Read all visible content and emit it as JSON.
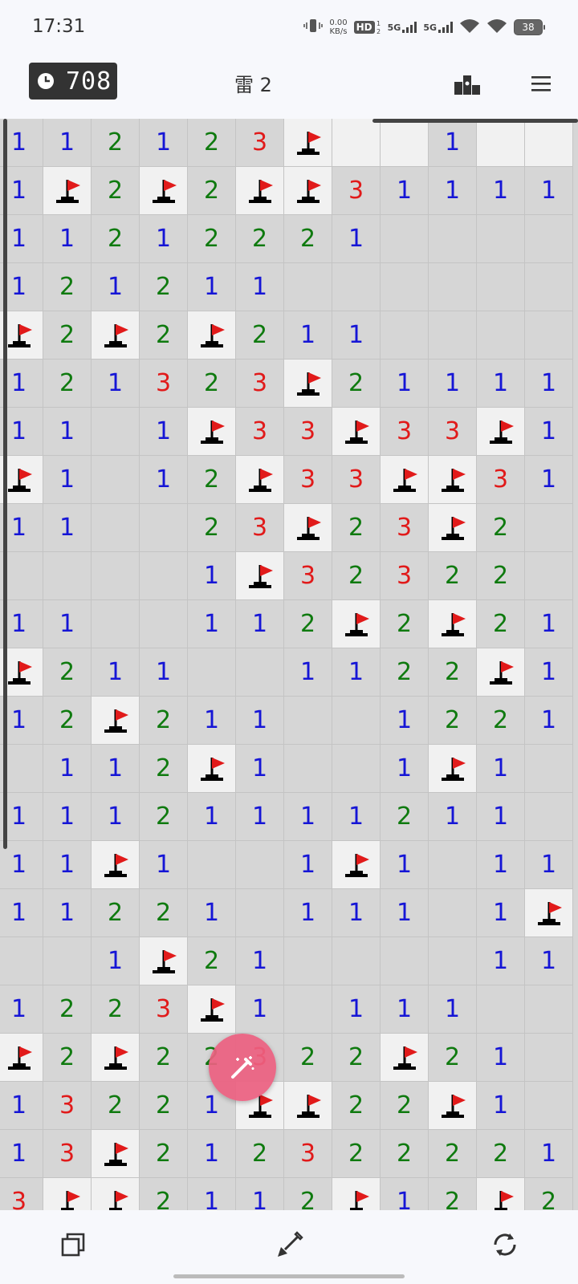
{
  "status": {
    "time": "17:31",
    "net_speed_value": "0.00",
    "net_speed_unit": "KB/s",
    "hd_label": "HD",
    "sim1_label": "5G",
    "sim2_label": "5G",
    "battery": "38"
  },
  "toolbar": {
    "timer_value": "708",
    "mine_label": "雷 2"
  },
  "board": {
    "rows": [
      [
        "1",
        "1",
        "2",
        "1",
        "2",
        "3",
        "F",
        "U",
        "U",
        "1",
        "U",
        "U"
      ],
      [
        "1",
        "F",
        "2",
        "F",
        "2",
        "F",
        "F",
        "3",
        "1",
        "1",
        "1",
        "1"
      ],
      [
        "1",
        "1",
        "2",
        "1",
        "2",
        "2",
        "2",
        "1",
        "",
        "",
        "",
        ""
      ],
      [
        "1",
        "2",
        "1",
        "2",
        "1",
        "1",
        "",
        "",
        "",
        "",
        "",
        ""
      ],
      [
        "F",
        "2",
        "F",
        "2",
        "F",
        "2",
        "1",
        "1",
        "",
        "",
        "",
        ""
      ],
      [
        "1",
        "2",
        "1",
        "3",
        "2",
        "3",
        "F",
        "2",
        "1",
        "1",
        "1",
        "1"
      ],
      [
        "1",
        "1",
        "",
        "1",
        "F",
        "3",
        "3",
        "F",
        "3",
        "3",
        "F",
        "1"
      ],
      [
        "F",
        "1",
        "",
        "1",
        "2",
        "F",
        "3",
        "3",
        "F",
        "F",
        "3",
        "1"
      ],
      [
        "1",
        "1",
        "",
        "",
        "2",
        "3",
        "F",
        "2",
        "3",
        "F",
        "2",
        ""
      ],
      [
        "",
        "",
        "",
        "",
        "1",
        "F",
        "3",
        "2",
        "3",
        "2",
        "2",
        ""
      ],
      [
        "1",
        "1",
        "",
        "",
        "1",
        "1",
        "2",
        "F",
        "2",
        "F",
        "2",
        "1"
      ],
      [
        "F",
        "2",
        "1",
        "1",
        "",
        "",
        "1",
        "1",
        "2",
        "2",
        "F",
        "1"
      ],
      [
        "1",
        "2",
        "F",
        "2",
        "1",
        "1",
        "",
        "",
        "1",
        "2",
        "2",
        "1"
      ],
      [
        "",
        "1",
        "1",
        "2",
        "F",
        "1",
        "",
        "",
        "1",
        "F",
        "1",
        ""
      ],
      [
        "1",
        "1",
        "1",
        "2",
        "1",
        "1",
        "1",
        "1",
        "2",
        "1",
        "1",
        ""
      ],
      [
        "1",
        "1",
        "F",
        "1",
        "",
        "",
        "1",
        "F",
        "1",
        "",
        "1",
        "1"
      ],
      [
        "1",
        "1",
        "2",
        "2",
        "1",
        "",
        "1",
        "1",
        "1",
        "",
        "1",
        "F"
      ],
      [
        "",
        "",
        "1",
        "F",
        "2",
        "1",
        "",
        "",
        "",
        "",
        "1",
        "1"
      ],
      [
        "1",
        "2",
        "2",
        "3",
        "F",
        "1",
        "",
        "1",
        "1",
        "1",
        "",
        ""
      ],
      [
        "F",
        "2",
        "F",
        "2",
        "2",
        "3",
        "2",
        "2",
        "F",
        "2",
        "1",
        ""
      ],
      [
        "1",
        "3",
        "2",
        "2",
        "1",
        "F",
        "F",
        "2",
        "2",
        "F",
        "1",
        ""
      ],
      [
        "1",
        "3",
        "F",
        "2",
        "1",
        "2",
        "3",
        "2",
        "2",
        "2",
        "2",
        "1"
      ],
      [
        "3",
        "F",
        "F",
        "2",
        "1",
        "1",
        "2",
        "F",
        "1",
        "2",
        "F",
        "2"
      ]
    ]
  },
  "colors": {
    "one": "#1515d6",
    "two": "#0f7a0f",
    "three": "#e11a1a",
    "fab": "#ec6080",
    "timer_bg": "#333333"
  },
  "icons": {
    "timer": "clock-icon",
    "leaderboard": "podium-icon",
    "menu": "hamburger-icon",
    "fab": "magic-wand-icon",
    "copy": "copy-icon",
    "shovel": "shovel-icon",
    "restart": "refresh-icon"
  }
}
